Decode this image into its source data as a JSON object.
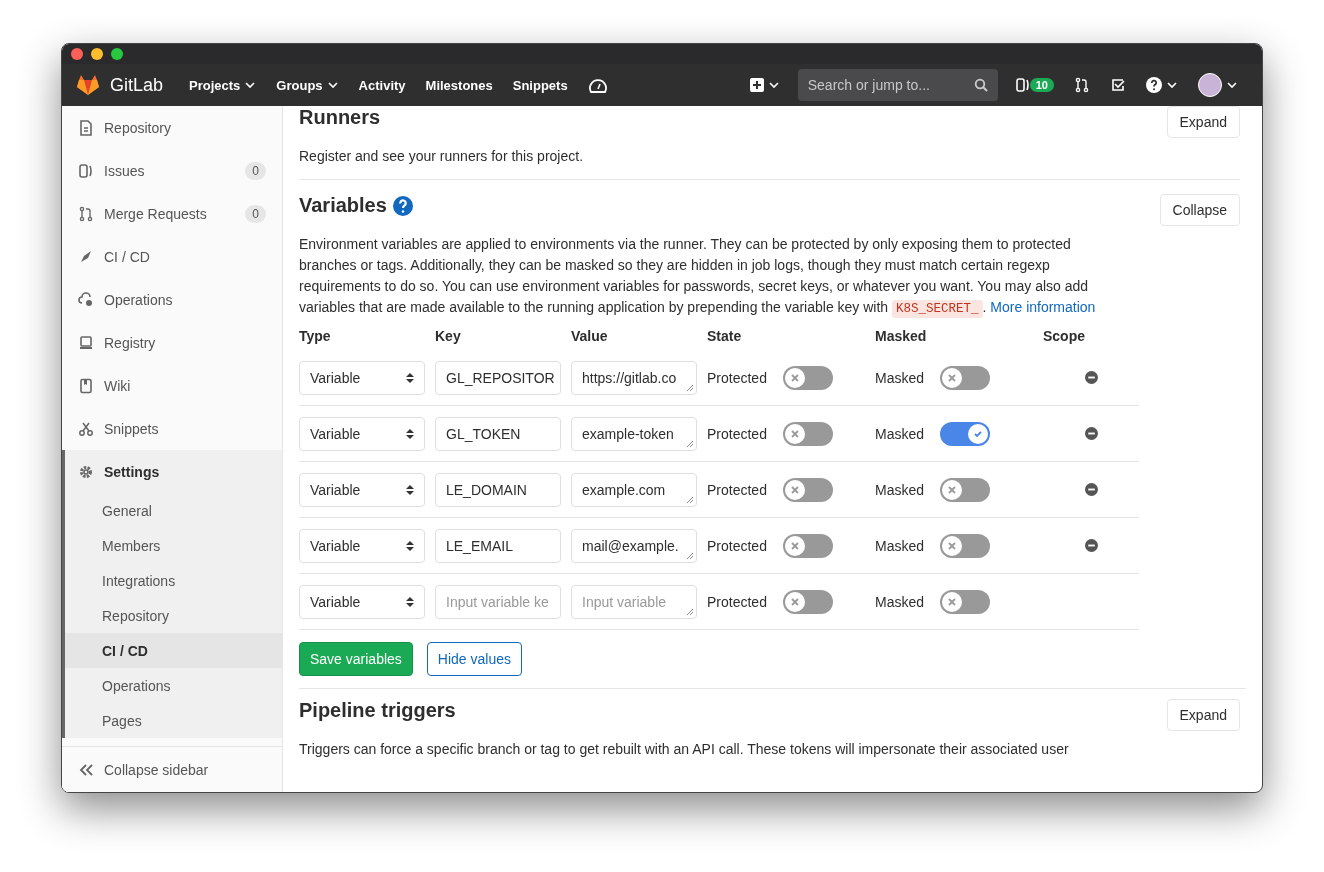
{
  "navbar": {
    "brand": "GitLab",
    "links": [
      {
        "label": "Projects",
        "dropdown": true
      },
      {
        "label": "Groups",
        "dropdown": true
      },
      {
        "label": "Activity",
        "dropdown": false
      },
      {
        "label": "Milestones",
        "dropdown": false
      },
      {
        "label": "Snippets",
        "dropdown": false
      }
    ],
    "search": {
      "placeholder": "Search or jump to..."
    },
    "issues_badge": "10"
  },
  "sidebar": {
    "items": [
      {
        "label": "Repository",
        "selected": false
      },
      {
        "label": "Issues",
        "count": "0",
        "selected": false
      },
      {
        "label": "Merge Requests",
        "count": "0",
        "selected": false
      },
      {
        "label": "CI / CD",
        "selected": false
      },
      {
        "label": "Operations",
        "selected": false
      },
      {
        "label": "Registry",
        "selected": false
      },
      {
        "label": "Wiki",
        "selected": false
      },
      {
        "label": "Snippets",
        "selected": false
      },
      {
        "label": "Settings",
        "selected": true,
        "expanded": true,
        "children": [
          {
            "label": "General",
            "selected": false
          },
          {
            "label": "Members",
            "selected": false
          },
          {
            "label": "Integrations",
            "selected": false
          },
          {
            "label": "Repository",
            "selected": false
          },
          {
            "label": "CI / CD",
            "selected": true
          },
          {
            "label": "Operations",
            "selected": false
          },
          {
            "label": "Pages",
            "selected": false
          }
        ]
      }
    ],
    "collapse": "Collapse sidebar"
  },
  "runners": {
    "title": "Runners",
    "button": "Expand",
    "description": "Register and see your runners for this project."
  },
  "variables": {
    "title": "Variables",
    "button": "Collapse",
    "description": "Environment variables are applied to environments via the runner. They can be protected by only exposing them to protected branches or tags. Additionally, they can be masked so they are hidden in job logs, though they must match certain regexp requirements to do so. You can use environment variables for passwords, secret keys, or whatever you want. You may also add variables that are made available to the running application by prepending the variable key with",
    "code": "K8S_SECRET_",
    "description_end": ".",
    "link": "More information",
    "columns": [
      "Type",
      "Key",
      "Value",
      "State",
      "Masked",
      "Scope"
    ],
    "rows": [
      {
        "type": "Variable",
        "key": "GL_REPOSITOR",
        "value": "https://gitlab.co",
        "state_label": "Protected",
        "protected": false,
        "masked_label": "Masked",
        "masked": false,
        "removable": true
      },
      {
        "type": "Variable",
        "key": "GL_TOKEN",
        "value": "example-token",
        "state_label": "Protected",
        "protected": false,
        "masked_label": "Masked",
        "masked": true,
        "removable": true
      },
      {
        "type": "Variable",
        "key": "LE_DOMAIN",
        "value": "example.com",
        "state_label": "Protected",
        "protected": false,
        "masked_label": "Masked",
        "masked": false,
        "removable": true
      },
      {
        "type": "Variable",
        "key": "LE_EMAIL",
        "value": "mail@example.",
        "state_label": "Protected",
        "protected": false,
        "masked_label": "Masked",
        "masked": false,
        "removable": true
      },
      {
        "type": "Variable",
        "key_placeholder": "Input variable ke",
        "value_placeholder": "Input variable",
        "state_label": "Protected",
        "protected": false,
        "masked_label": "Masked",
        "masked": false,
        "removable": false
      }
    ],
    "save_button": "Save variables",
    "hide_button": "Hide values"
  },
  "pipeline_triggers": {
    "title": "Pipeline triggers",
    "button": "Expand",
    "description": "Triggers can force a specific branch or tag to get rebuilt with an API call. These tokens will impersonate their associated user"
  }
}
